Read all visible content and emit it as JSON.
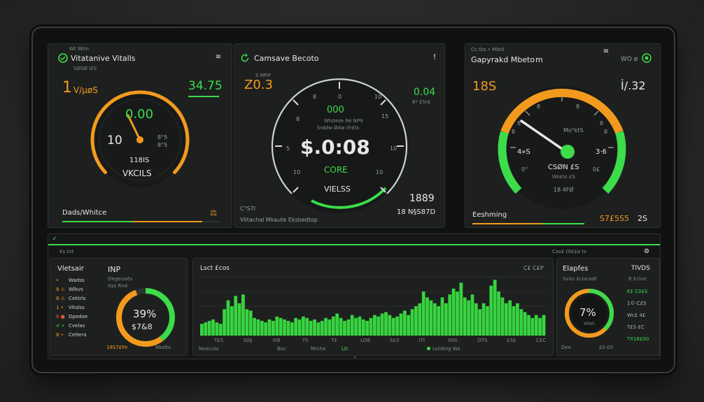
{
  "panel1": {
    "top_label": "Wt Wtin",
    "title": "Vitatanive Vitalls",
    "subtitle": "SØSØ I£S",
    "left_value": "1",
    "left_unit": "V/μøS",
    "right_value": "34.75",
    "gauge_top": "0.00",
    "gauge_left": "10",
    "gauge_tick": "8°5",
    "gauge_code": "8°5",
    "gauge_mid": "118IS",
    "gauge_label": "VKCILS",
    "footer_label": "Dads/Whitce",
    "footer_icon": "⚖"
  },
  "panel2": {
    "title": "Camsave Becoto",
    "left_top": "S NPIF",
    "left_value": "Z0.3",
    "right_value": "0.04",
    "right_sub": "6º £Sr£",
    "center_small": "000",
    "center_lines": "Wtsteze Ré NP9",
    "center_lines2": "Srødw Ødw Ifr£ts",
    "center_value": "$.0:08",
    "center_code": "CORE",
    "center_label": "VIELSS",
    "ticks": [
      "8",
      "0",
      "10",
      "8",
      "15",
      "5",
      "10",
      "10",
      "10"
    ],
    "bottom_left_code": "C°S7I",
    "bottom_right_value": "1889",
    "bottom_right_sub": "18 N§S87D",
    "footer_label": "Viltachal Mkaute Eksbedtop"
  },
  "panel3": {
    "top_label": "Cs tbs • Mbtő",
    "title": "Gapyrakd Mbeto",
    "title_sub": "m",
    "right_top": "WO ø",
    "left_value": "18S",
    "right_value": "İ/.32",
    "gauge_label": "Mo°ktS",
    "gauge_left": "4»S",
    "gauge_right": "3·6",
    "gauge_code": "CSØN £S",
    "gauge_sub": "Wo£ts £S",
    "gauge_sub2": "18 4FØ",
    "ticks": [
      "8",
      "8",
      "8",
      "8",
      "8",
      "8"
    ],
    "bottom_left": "0°",
    "bottom_right": "0£",
    "footer_label": "Eeshming",
    "footer_value": "S7£5S5",
    "footer_value2": "2S"
  },
  "bottom": {
    "header_left": "Ks.tnt",
    "header_right_label": "Cas£ Ol££ø ts",
    "list_title": "Vletsair",
    "list_items": [
      {
        "label": "Wadss",
        "icon": "•",
        "color": "#f39a1e"
      },
      {
        "label": "Wlkvs",
        "icon": "8 ⚠",
        "color": "#f39a1e"
      },
      {
        "label": "Cektrls",
        "icon": "8 ⚠",
        "color": "#f39a1e"
      },
      {
        "label": "Vitolss",
        "icon": "1 •",
        "color": "#f39a1e"
      },
      {
        "label": "Dpedoe",
        "icon": "8 ●",
        "color": "#e85a2c"
      },
      {
        "label": "Cvelas",
        "icon": "✔ •",
        "color": "#3cdc4a"
      },
      {
        "label": "Cetlera",
        "icon": "8 •",
        "color": "#f39a1e"
      }
    ],
    "inp_title": "INP",
    "inp_sub": "Degeuoés",
    "inp_sub2": "Itss Rnd",
    "inp_value": "39%",
    "inp_value2": "$7&8",
    "inp_footer_left": "18S7£Fe",
    "inp_footer_right": "Nkalts",
    "chart_title": "Lsct £cos",
    "chart_right": "C£ C£P",
    "chart_xlabels": [
      "T£S",
      "S0§",
      "0I8",
      "7S",
      "T£",
      "LO8",
      "S£3",
      "ITI",
      "0IIS",
      "OTS",
      "£S£",
      "C£C"
    ],
    "chart_legend_left": "Neacuts",
    "chart_legend_mid": "Boc",
    "chart_legend_mid2": "Mrcha",
    "chart_legend_mid3": "LO",
    "chart_legend_right": "Lsiiding Wa",
    "ring_title": "Elapfes",
    "ring_sub": "Sv£o £ciscadt",
    "ring_value": "7%",
    "ring_label": "Vlen",
    "ring_footer_left": "Dee",
    "ring_footer_right": "£0 £0",
    "right_col_title": "TIVDS",
    "right_col_sub": "8 £clue",
    "right_col_items": [
      "€£ C0£S",
      "1©·C£S",
      "Wc£ 4£",
      "T£S £C",
      "TX18£00"
    ],
    "chart_data": {
      "type": "bar",
      "series": [
        {
          "values": [
            8,
            9,
            10,
            11,
            9,
            8,
            18,
            24,
            20,
            27,
            22,
            28,
            18,
            17,
            12,
            11,
            10,
            9,
            11,
            10,
            13,
            12,
            11,
            10,
            9,
            12,
            11,
            13,
            12,
            10,
            11,
            9,
            10,
            12,
            11,
            13,
            15,
            12,
            10,
            11,
            14,
            12,
            13,
            11,
            10,
            12,
            14,
            13,
            15,
            16,
            14,
            12,
            13,
            15,
            17,
            14,
            18,
            20,
            22,
            30,
            26,
            24,
            22,
            20,
            26,
            22,
            28,
            32,
            30,
            36,
            26,
            24,
            28,
            22,
            18,
            22,
            20,
            34,
            38,
            30,
            26,
            22,
            24,
            20,
            22,
            18,
            16,
            14,
            12,
            14,
            12,
            14
          ]
        }
      ],
      "ylim": [
        0,
        40
      ]
    }
  },
  "colors": {
    "orange": "#f39a1e",
    "green": "#3cdc4a",
    "panel": "#1d201f",
    "bg": "#101211"
  }
}
